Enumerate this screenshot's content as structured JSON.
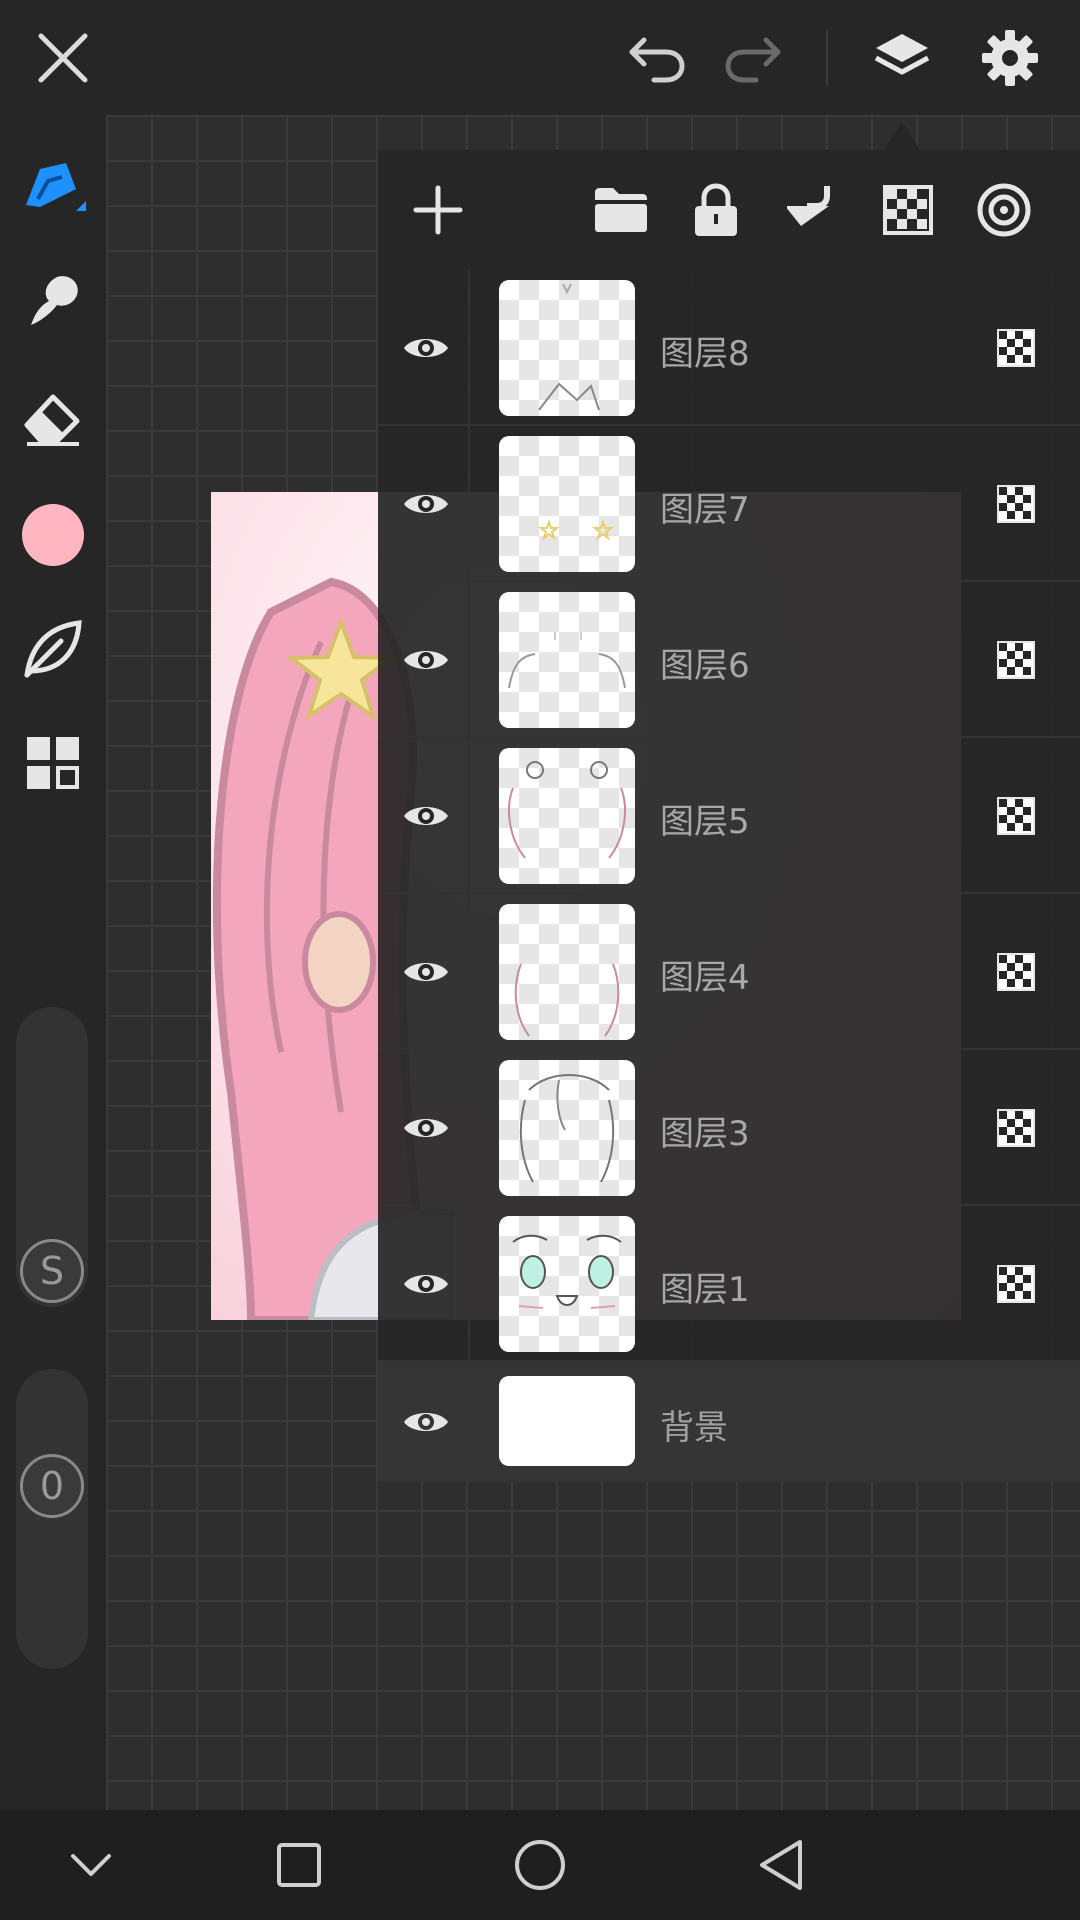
{
  "app": {
    "accent_color": "#1e90ff",
    "current_color": "#ffb6c1"
  },
  "top_bar": {
    "icons": [
      "close-icon",
      "undo-icon",
      "redo-icon",
      "layers-icon",
      "settings-icon"
    ]
  },
  "left_toolbar": {
    "tools": [
      "pen-icon",
      "smudge-icon",
      "eraser-icon",
      "color-swatch",
      "leaf-icon",
      "grid-icon"
    ],
    "size_slider_label": "S",
    "opacity_slider_label": "0"
  },
  "layer_panel": {
    "toolbar_icons": [
      "add-layer-icon",
      "folder-icon",
      "lock-icon",
      "merge-down-icon",
      "alpha-lock-icon",
      "clipping-icon"
    ],
    "layers": [
      {
        "name": "图层8",
        "visible": true
      },
      {
        "name": "图层7",
        "visible": true
      },
      {
        "name": "图层6",
        "visible": true
      },
      {
        "name": "图层5",
        "visible": true
      },
      {
        "name": "图层4",
        "visible": true
      },
      {
        "name": "图层3",
        "visible": true
      },
      {
        "name": "图层1",
        "visible": true
      }
    ],
    "background_layer": {
      "name": "背景",
      "visible": true
    }
  },
  "bottom_nav": {
    "icons": [
      "chevron-down-icon",
      "recent-apps-icon",
      "home-icon",
      "back-icon"
    ]
  }
}
